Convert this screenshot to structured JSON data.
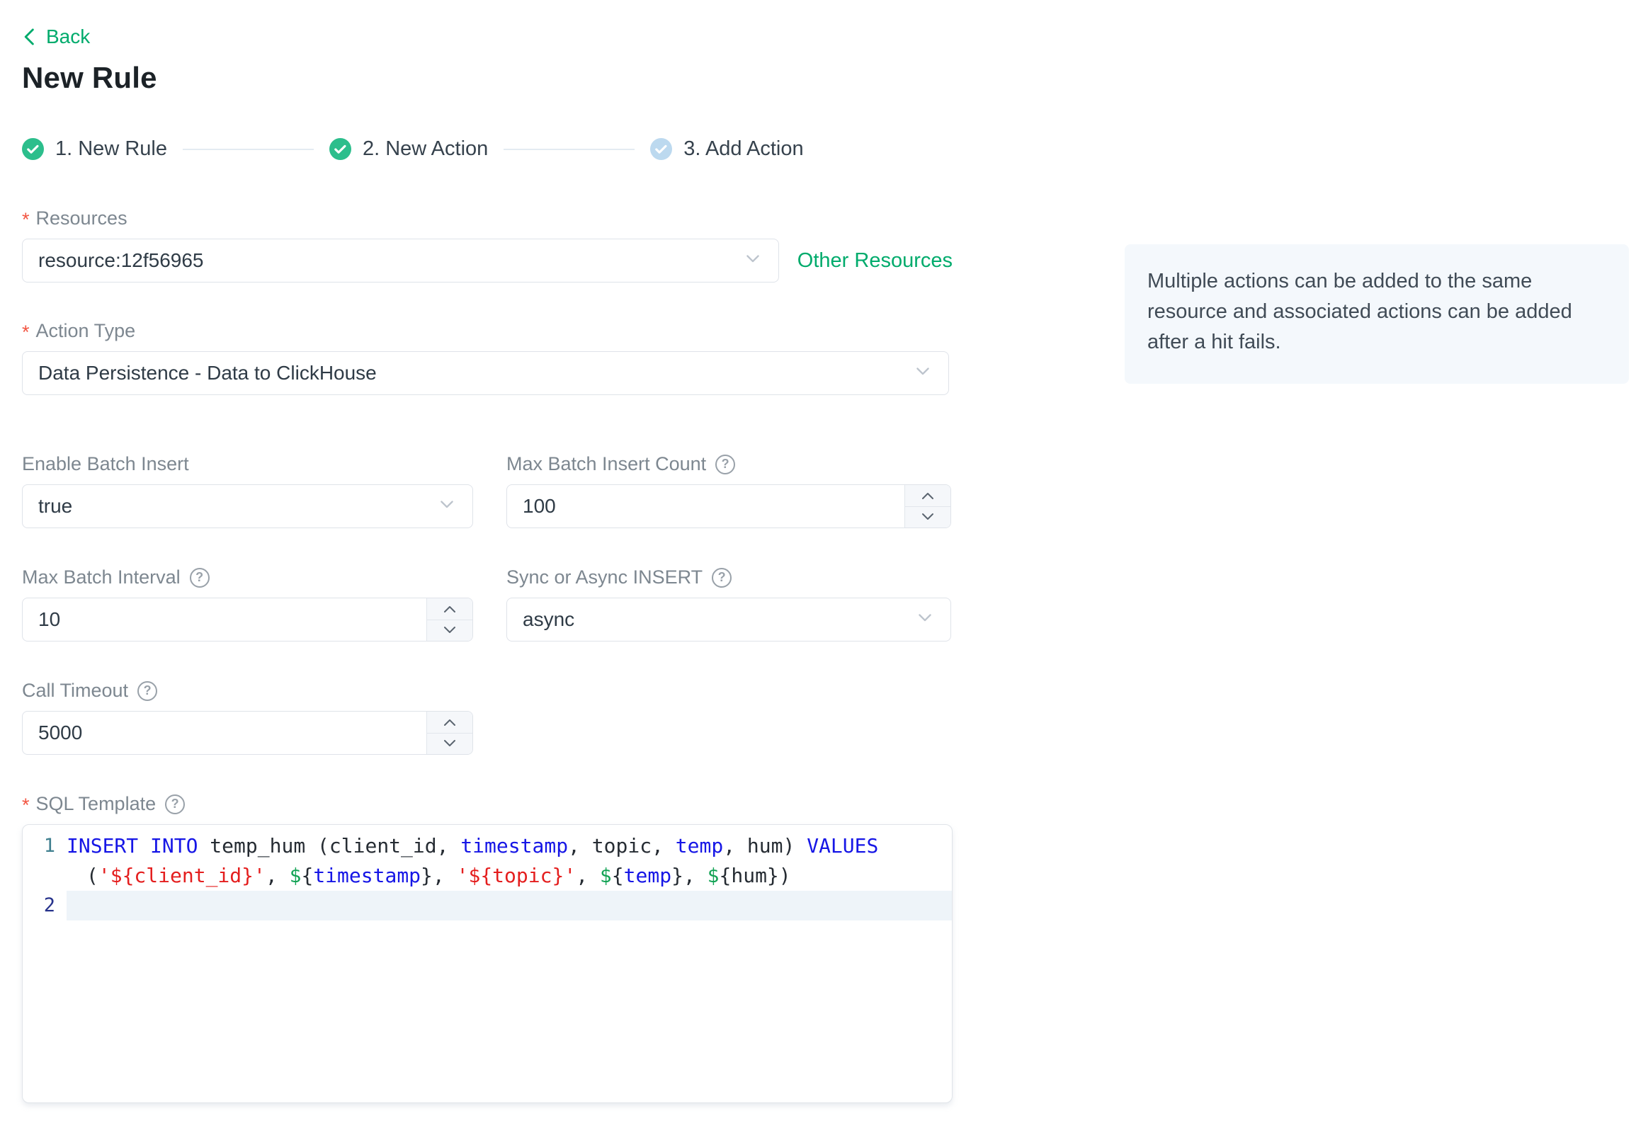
{
  "required_marker": "*",
  "back": {
    "label": "Back"
  },
  "title": "New Rule",
  "steps": [
    {
      "label": "1. New Rule",
      "state": "done"
    },
    {
      "label": "2. New Action",
      "state": "done"
    },
    {
      "label": "3. Add Action",
      "state": "pending"
    }
  ],
  "form": {
    "resources": {
      "label": "Resources",
      "required": true,
      "value": "resource:12f56965",
      "side_link": "Other Resources"
    },
    "info_tip": "Multiple actions can be added to the same resource and associated actions can be added after a hit fails.",
    "action_type": {
      "label": "Action Type",
      "required": true,
      "value": "Data Persistence - Data to ClickHouse"
    },
    "enable_batch": {
      "label": "Enable Batch Insert",
      "value": "true"
    },
    "max_batch_count": {
      "label": "Max Batch Insert Count",
      "value": "100"
    },
    "max_batch_interval": {
      "label": "Max Batch Interval",
      "value": "10"
    },
    "sync_async": {
      "label": "Sync or Async INSERT",
      "value": "async"
    },
    "call_timeout": {
      "label": "Call Timeout",
      "value": "5000"
    },
    "sql_template": {
      "label": "SQL Template",
      "required": true
    }
  },
  "icons": {
    "help_glyph": "?"
  },
  "colors": {
    "link_green": "#00ab6c",
    "check_green": "#2cbe8c",
    "pending_blue": "#bcd9ef",
    "required_red": "#f25643",
    "info_bg": "#f4f8fc",
    "code_keyword": "#1616e6",
    "code_string": "#e41e1e",
    "code_dollar": "#13a355",
    "active_line_bg": "#eef4f9"
  },
  "editor": {
    "lines": [
      {
        "num": "1",
        "num_class": "ln-1",
        "active": false,
        "wraps": [
          [
            {
              "c": "kw",
              "t": "INSERT"
            },
            {
              "c": "plain",
              "t": " "
            },
            {
              "c": "kw",
              "t": "INTO"
            },
            {
              "c": "plain",
              "t": " temp_hum (client_id, "
            },
            {
              "c": "kw",
              "t": "timestamp"
            },
            {
              "c": "plain",
              "t": ", topic, "
            },
            {
              "c": "kw",
              "t": "temp"
            },
            {
              "c": "plain",
              "t": ", hum) "
            },
            {
              "c": "kw",
              "t": "VALUES"
            }
          ],
          [
            {
              "c": "plain",
              "t": "("
            },
            {
              "c": "str",
              "t": "'${client_id}'"
            },
            {
              "c": "plain",
              "t": ", "
            },
            {
              "c": "dollar",
              "t": "$"
            },
            {
              "c": "plain",
              "t": "{"
            },
            {
              "c": "kw",
              "t": "timestamp"
            },
            {
              "c": "plain",
              "t": "}, "
            },
            {
              "c": "str",
              "t": "'${topic}'"
            },
            {
              "c": "plain",
              "t": ", "
            },
            {
              "c": "dollar",
              "t": "$"
            },
            {
              "c": "plain",
              "t": "{"
            },
            {
              "c": "kw",
              "t": "temp"
            },
            {
              "c": "plain",
              "t": "}, "
            },
            {
              "c": "dollar",
              "t": "$"
            },
            {
              "c": "plain",
              "t": "{hum})"
            }
          ]
        ]
      },
      {
        "num": "2",
        "num_class": "ln-2",
        "active": true,
        "wraps": [
          []
        ]
      }
    ]
  }
}
